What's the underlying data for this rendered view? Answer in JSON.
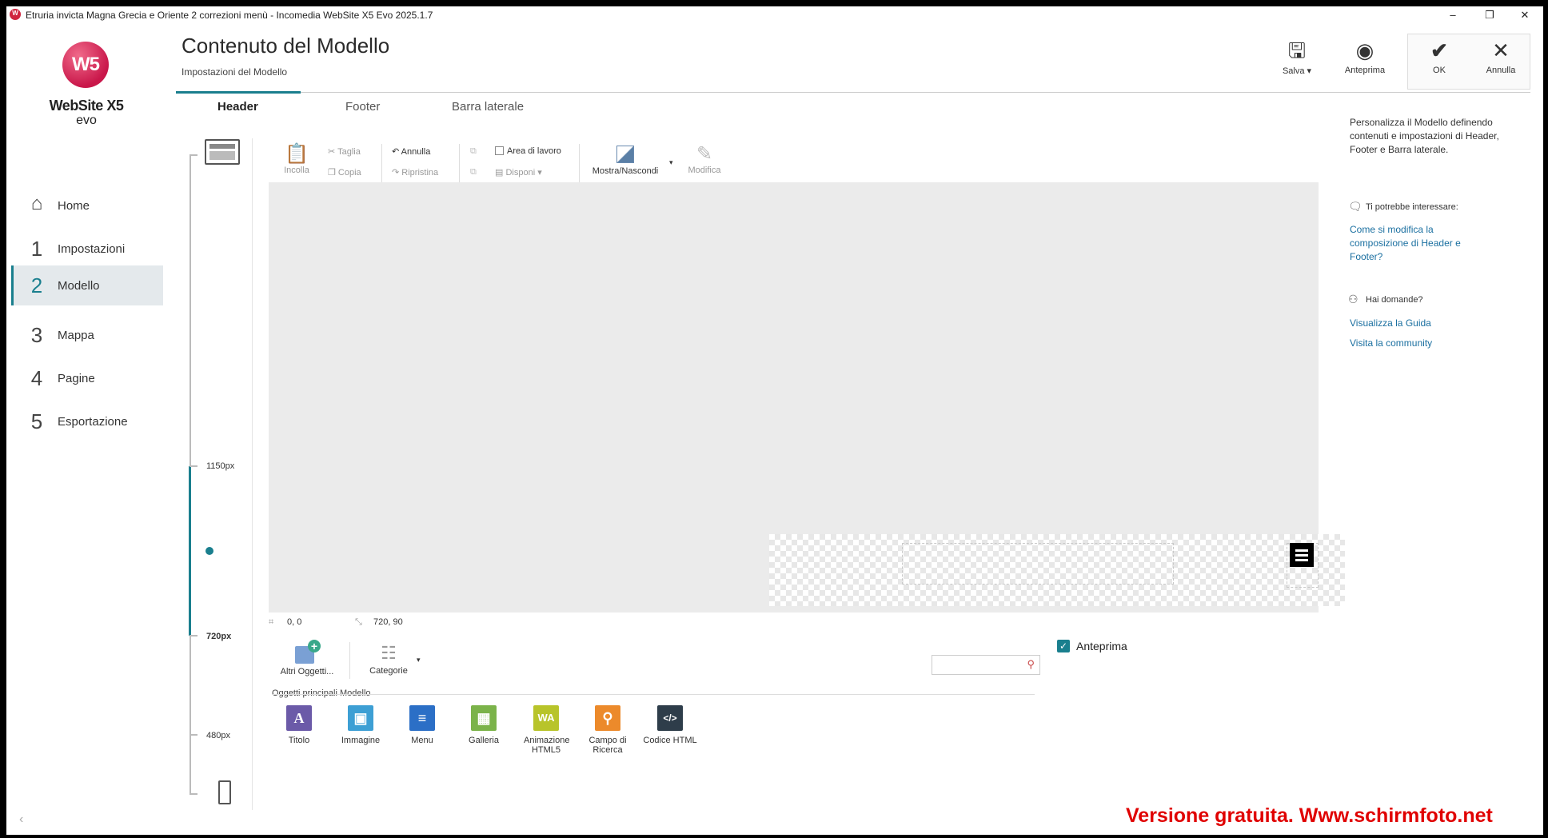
{
  "window": {
    "title": "Etruria invicta Magna Grecia e Oriente 2 correzioni menù - Incomedia WebSite X5 Evo 2025.1.7",
    "minimize": "–",
    "maximize": "❐",
    "close": "✕"
  },
  "logo": {
    "mark": "W5",
    "name": "WebSite X5",
    "edition": "evo"
  },
  "nav": [
    {
      "num": "⌂",
      "label": "Home"
    },
    {
      "num": "1",
      "label": "Impostazioni"
    },
    {
      "num": "2",
      "label": "Modello"
    },
    {
      "num": "3",
      "label": "Mappa"
    },
    {
      "num": "4",
      "label": "Pagine"
    },
    {
      "num": "5",
      "label": "Esportazione"
    }
  ],
  "header": {
    "title": "Contenuto del Modello",
    "subtitle": "Impostazioni del Modello",
    "save": "Salva",
    "preview": "Anteprima",
    "ok": "OK",
    "cancel": "Annulla"
  },
  "tabs": [
    "Header",
    "Footer",
    "Barra laterale"
  ],
  "ruler": {
    "r1": "1150px",
    "r2": "720px",
    "r3": "480px"
  },
  "toolbar": {
    "paste": "Incolla",
    "cut": "Taglia",
    "copy": "Copia",
    "undo": "Annulla",
    "redo": "Ripristina",
    "workarea": "Area di lavoro",
    "arrange": "Disponi",
    "showhide": "Mostra/Nascondi",
    "edit": "Modifica"
  },
  "status": {
    "pos": "0, 0",
    "size": "720, 90"
  },
  "objects": {
    "more": "Altri Oggetti...",
    "categories": "Categorie",
    "section": "Oggetti principali Modello",
    "items": [
      {
        "label": "Titolo",
        "color": "#6b5aa8",
        "glyph": "A"
      },
      {
        "label": "Immagine",
        "color": "#3d9fd4",
        "glyph": "▣"
      },
      {
        "label": "Menu",
        "color": "#2b6fc6",
        "glyph": "≡"
      },
      {
        "label": "Galleria",
        "color": "#7bb34a",
        "glyph": "▦"
      },
      {
        "label": "Animazione HTML5",
        "color": "#b8c42a",
        "glyph": "WA"
      },
      {
        "label": "Campo di Ricerca",
        "color": "#ec8a2b",
        "glyph": "⚲"
      },
      {
        "label": "Codice HTML",
        "color": "#2e3d4a",
        "glyph": "</>"
      }
    ],
    "preview_label": "Anteprima"
  },
  "right_panel": {
    "intro": "Personalizza il Modello definendo contenuti e impostazioni di Header, Footer e Barra laterale.",
    "interest_head": "Ti potrebbe interessare:",
    "interest_link": "Come si modifica la composizione di Header e Footer?",
    "questions_head": "Hai domande?",
    "guide_link": "Visualizza la Guida",
    "community_link": "Visita la community"
  },
  "watermark": "Versione gratuita. Www.schirmfoto.net"
}
